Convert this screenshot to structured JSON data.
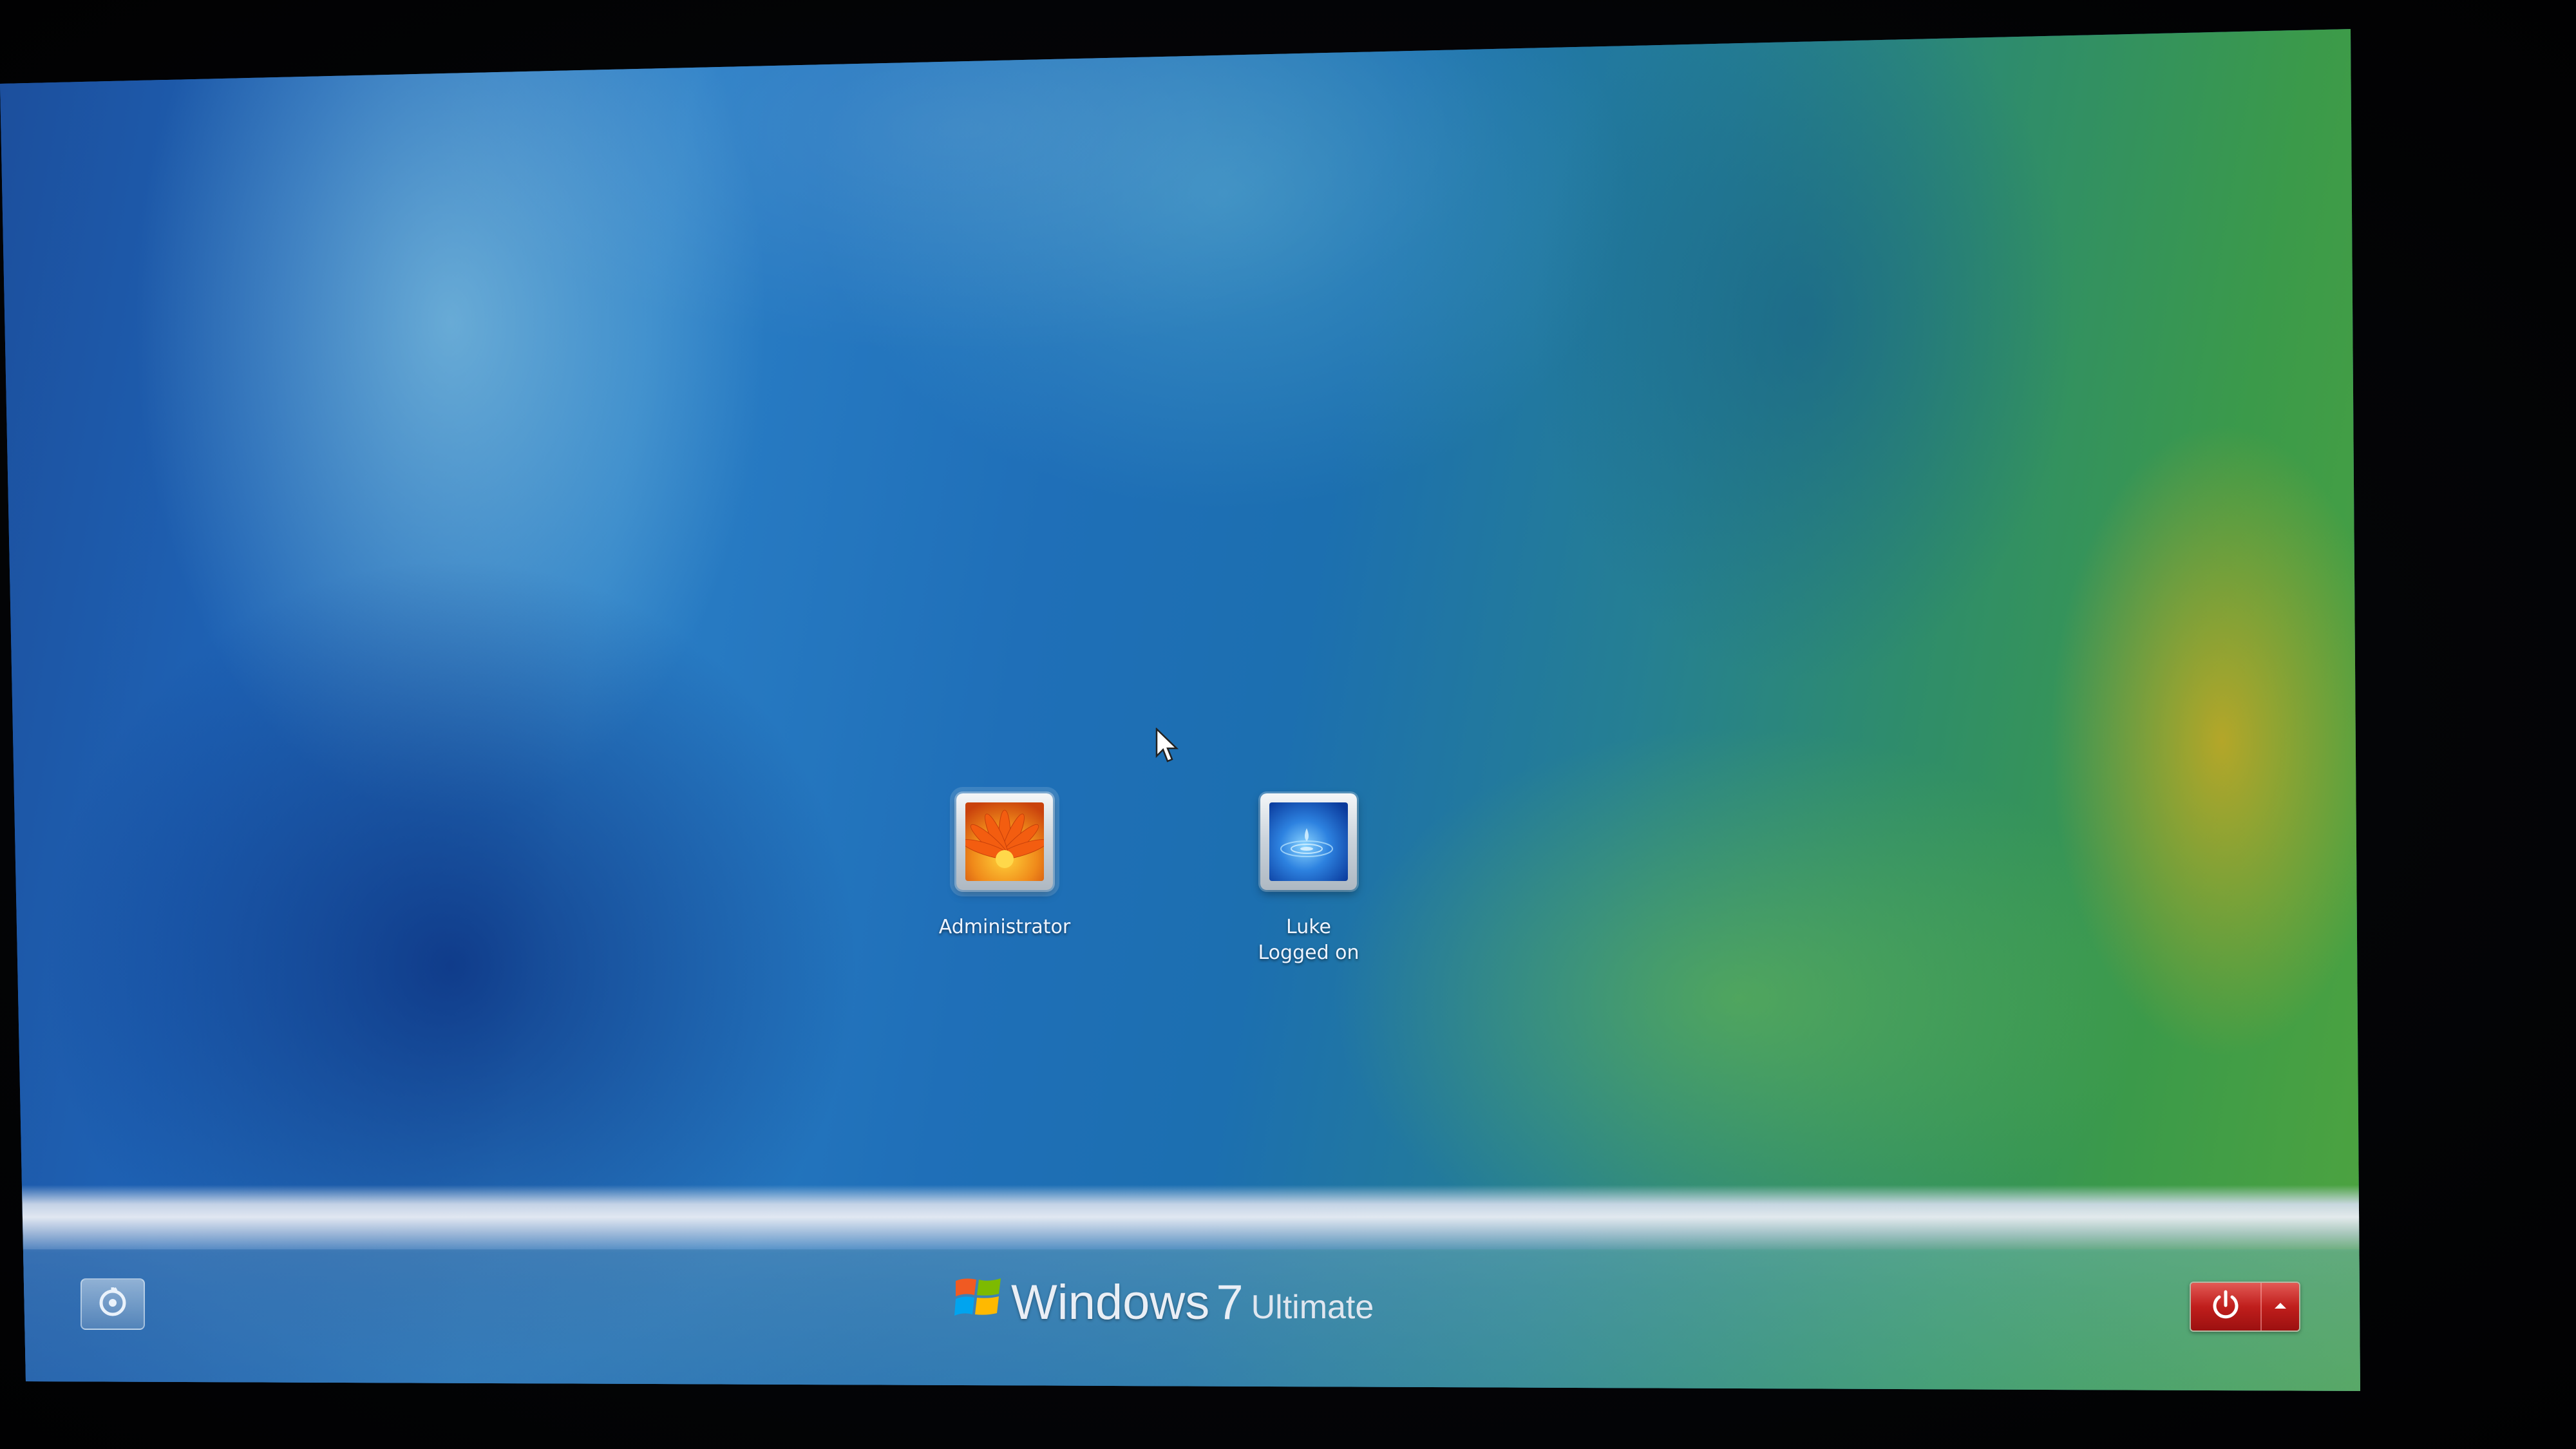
{
  "os": {
    "name": "Windows",
    "version": "7",
    "edition": "Ultimate"
  },
  "users": [
    {
      "name": "Administrator",
      "status": ""
    },
    {
      "name": "Luke",
      "status": "Logged on"
    }
  ],
  "controls": {
    "ease_of_access_icon": "ease-of-access-icon",
    "shutdown_icon": "power-icon",
    "shutdown_options_icon": "chevron-up-icon"
  },
  "colors": {
    "shutdown_red": "#c01e1c",
    "label_text": "#eef4ff"
  }
}
